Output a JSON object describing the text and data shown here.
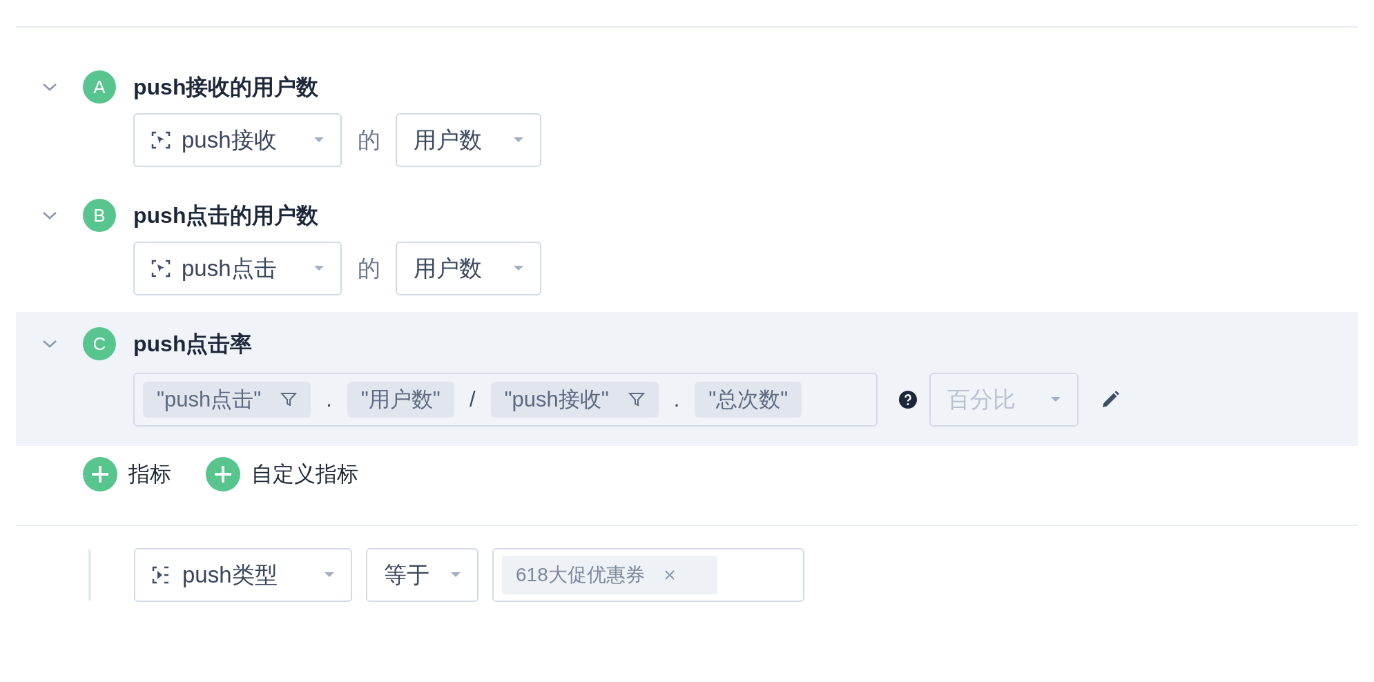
{
  "metrics": [
    {
      "letter": "A",
      "title": "push接收的用户数",
      "expanded": true,
      "selected": false,
      "kind": "simple",
      "event": "push接收",
      "connector": "的",
      "measure": "用户数"
    },
    {
      "letter": "B",
      "title": "push点击的用户数",
      "expanded": true,
      "selected": false,
      "kind": "simple",
      "event": "push点击",
      "connector": "的",
      "measure": "用户数"
    },
    {
      "letter": "C",
      "title": "push点击率",
      "expanded": true,
      "selected": true,
      "kind": "formula",
      "formula": [
        {
          "kind": "operand",
          "label": "\"push点击\"",
          "filter": true
        },
        {
          "kind": "operator",
          "label": "."
        },
        {
          "kind": "operand",
          "label": "\"用户数\"",
          "filter": false
        },
        {
          "kind": "operator",
          "label": "/"
        },
        {
          "kind": "operand",
          "label": "\"push接收\"",
          "filter": true
        },
        {
          "kind": "operator",
          "label": "."
        },
        {
          "kind": "operand",
          "label": "\"总次数\"",
          "filter": false
        }
      ],
      "format": {
        "label": "百分比",
        "disabled": true
      }
    }
  ],
  "add_buttons": [
    {
      "label": "指标"
    },
    {
      "label": "自定义指标"
    }
  ],
  "filter": {
    "property": "push类型",
    "operator": "等于",
    "values": [
      {
        "label": "618大促优惠券"
      }
    ]
  }
}
